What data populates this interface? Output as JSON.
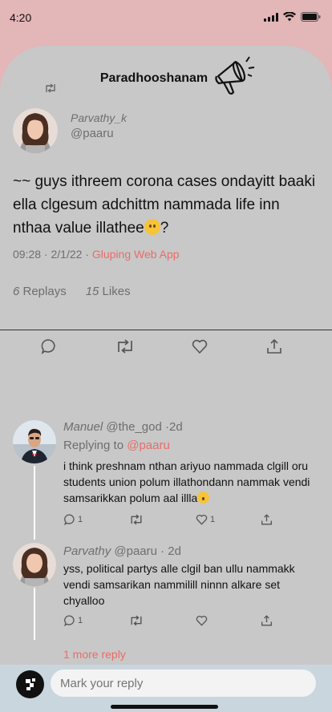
{
  "status": {
    "time": "4:20"
  },
  "header": {
    "title": "Paradhooshanam"
  },
  "post": {
    "name": "Parvathy_k",
    "handle": "@paaru",
    "text": "~~ guys ithreem corona cases ondayitt baaki ella clgesum adchittm nammada life inn nthaa value illathee",
    "text_end": "?",
    "meta_time": "09:28 · 2/1/22 · ",
    "meta_app": "Gluping Web App",
    "replies_count": "6",
    "replies_label": " Replays",
    "likes_count": "15",
    "likes_label": " Likes"
  },
  "replies": [
    {
      "name": "Manuel",
      "handle_time": " @the_god ·2d",
      "replying_label": "Replying to ",
      "replying_to": "@paaru",
      "text": "i think preshnam nthan ariyuo nammada clgill oru students union polum illathondann nammak vendi samsarikkan polum aal illla",
      "comment_count": "1",
      "like_count": "1"
    },
    {
      "name": "Parvathy",
      "handle_time": " @paaru · 2d",
      "text": "yss, political partys alle clgil ban ullu nammakk vendi samsarikan nammilill ninnn alkare set chyalloo",
      "comment_count": "1"
    }
  ],
  "more_reply": "1 more reply",
  "composer": {
    "placeholder": "Mark your reply"
  },
  "colors": {
    "accent": "#e86d68",
    "background": "#e3b6b8",
    "card": "#c8c8c8",
    "bottom_bar": "#c9d6de"
  },
  "icons": [
    "retweet-icon",
    "megaphone-icon",
    "comment-icon",
    "heart-icon",
    "share-icon",
    "app-logo-icon"
  ]
}
